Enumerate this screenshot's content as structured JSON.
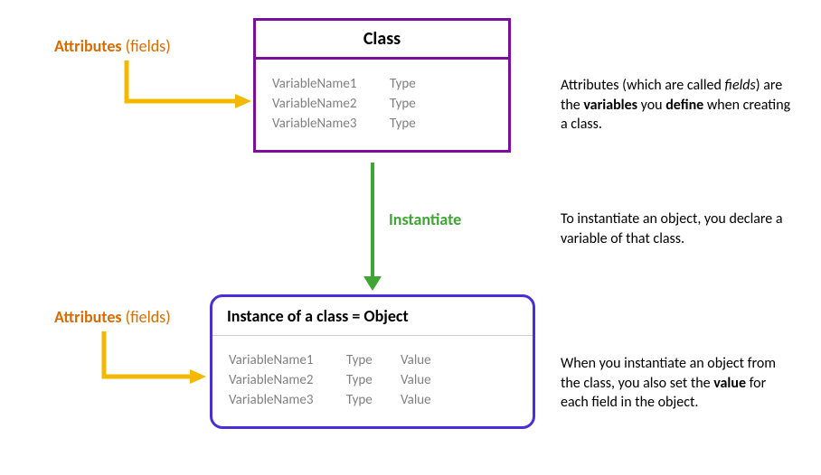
{
  "labels": {
    "attributes_word": "Attributes",
    "fields_word": " (fields)",
    "instantiate": "Instantiate"
  },
  "classBox": {
    "title": "Class",
    "rows": [
      {
        "name": "VariableName1",
        "type": "Type"
      },
      {
        "name": "VariableName2",
        "type": "Type"
      },
      {
        "name": "VariableName3",
        "type": "Type"
      }
    ]
  },
  "objectBox": {
    "title_pre": "Instance of a class = ",
    "title_bold": "Object",
    "rows": [
      {
        "name": "VariableName1",
        "type": "Type",
        "value": "Value"
      },
      {
        "name": "VariableName2",
        "type": "Type",
        "value": "Value"
      },
      {
        "name": "VariableName3",
        "type": "Type",
        "value": "Value"
      }
    ]
  },
  "rightText": {
    "desc1_pre": "Attributes (which are called ",
    "desc1_italic": "fields",
    "desc1_mid": ") are the ",
    "desc1_bold1": "variables",
    "desc1_mid2": " you ",
    "desc1_bold2": "define",
    "desc1_post": " when creating a class.",
    "desc2": "To instantiate an object, you declare a variable of that class.",
    "desc3_pre": "When you instantiate an object from the class, you also set the ",
    "desc3_bold": "value",
    "desc3_post": " for each field in the object."
  }
}
